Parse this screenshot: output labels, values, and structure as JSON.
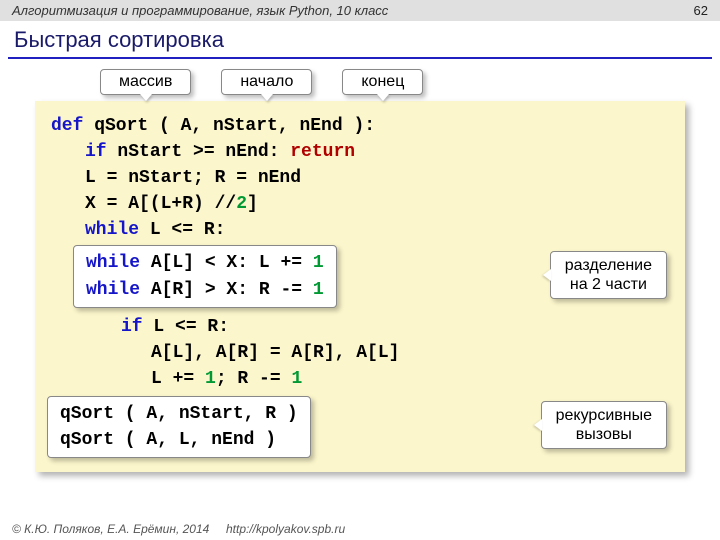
{
  "header": {
    "course": "Алгоритмизация и программирование, язык Python, 10 класс",
    "page": "62"
  },
  "title": "Быстрая сортировка",
  "top_labels": [
    "массив",
    "начало",
    "конец"
  ],
  "code": {
    "l1_def": "def",
    "l1_rest": " qSort ( A, nStart, nEnd ):",
    "l2_if": "if",
    "l2_mid": " nStart >= nEnd: ",
    "l2_ret": "return",
    "l3": "L = nStart; R = nEnd",
    "l4a": "X = A[(L+R) //",
    "l4b": "2",
    "l4c": "]",
    "l5_while": "while",
    "l5_rest": " L <= R:",
    "box1_l1a": "while",
    "box1_l1b": " A[L] < X: L += ",
    "box1_l1c": "1",
    "box1_l2a": "while",
    "box1_l2b": " A[R] > X: R -= ",
    "box1_l2c": "1",
    "l6_if": "if",
    "l6_rest": " L <= R:",
    "l7": "A[L], A[R] = A[R], A[L]",
    "l8a": "L += ",
    "l8b": "1",
    "l8c": "; R -= ",
    "l8d": "1",
    "box2_l1": "qSort ( A, nStart, R )",
    "box2_l2": "qSort ( A, L, nEnd )"
  },
  "side_labels": {
    "split_l1": "разделение",
    "split_l2": "на 2 части",
    "rec_l1": "рекурсивные",
    "rec_l2": "вызовы"
  },
  "footer": {
    "copyright": "© К.Ю. Поляков, Е.А. Ерёмин, 2014",
    "url": "http://kpolyakov.spb.ru"
  }
}
